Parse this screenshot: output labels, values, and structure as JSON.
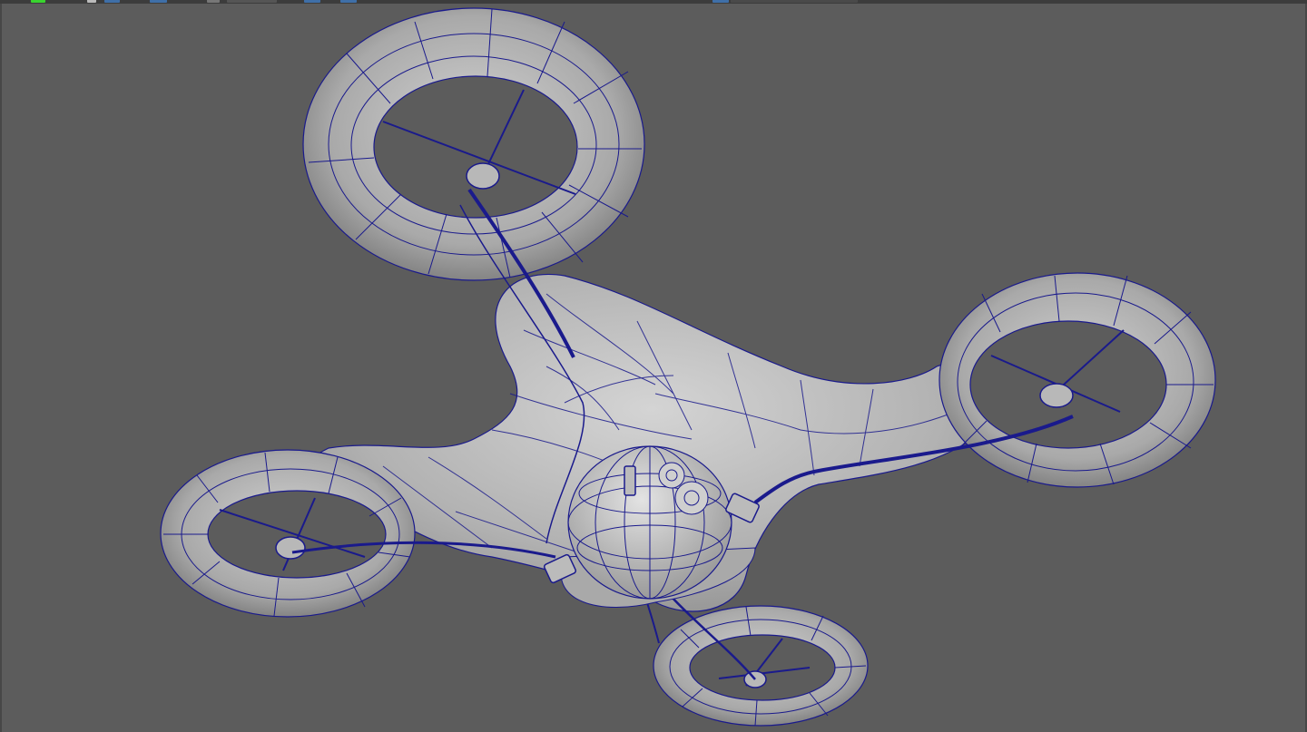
{
  "app": {
    "viewport_name": "perspective-viewport",
    "model_name": "drone-quadcopter-wireframe"
  },
  "colors": {
    "background": "#5c5c5c",
    "surface_light": "#c7c7c7",
    "surface_mid": "#9d9d9d",
    "surface_dark": "#6e6e6e",
    "wireframe": "#1a1a8c",
    "shelf_bg": "#3c3c3c",
    "shelf_accent_blue": "#3f6fa8",
    "shelf_accent_green": "#39d42f"
  },
  "shelf": {
    "icons": [
      "select-tool-icon",
      "layout-icon",
      "grid-snap-icon",
      "curve-snap-icon",
      "camera-icon",
      "display-icon",
      "shading-icon",
      "wireframe-toggle-icon",
      "isolate-icon"
    ]
  }
}
